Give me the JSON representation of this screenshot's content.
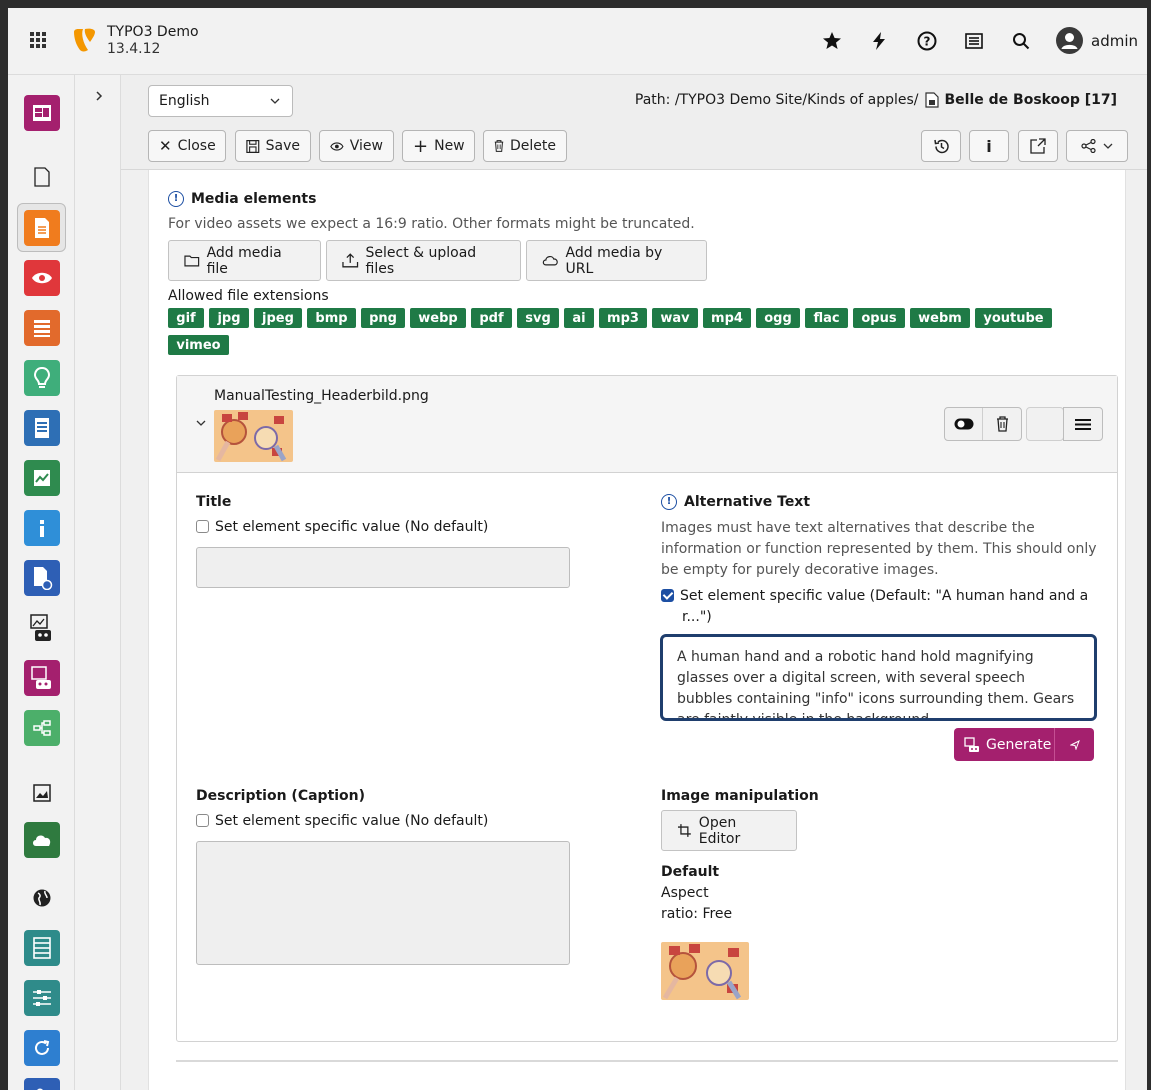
{
  "topbar": {
    "site_name": "TYPO3 Demo",
    "version": "13.4.12",
    "user": "admin",
    "icons": [
      "star-icon",
      "bolt-icon",
      "help-icon",
      "list-icon",
      "search-icon",
      "user-avatar-icon"
    ]
  },
  "docheader": {
    "language": "English",
    "path_label": "Path: /TYPO3 Demo Site/Kinds of apples/",
    "record_title": "Belle de Boskoop [17]",
    "buttons": {
      "close": "Close",
      "save": "Save",
      "view": "View",
      "new": "New",
      "delete": "Delete"
    }
  },
  "media": {
    "heading": "Media elements",
    "hint": "For video assets we expect a 16:9 ratio. Other formats might be truncated.",
    "add_media_file": "Add media file",
    "select_upload": "Select & upload files",
    "add_by_url": "Add media by URL",
    "allowed_label": "Allowed file extensions",
    "extensions": [
      "gif",
      "jpg",
      "jpeg",
      "bmp",
      "png",
      "webp",
      "pdf",
      "svg",
      "ai",
      "mp3",
      "wav",
      "mp4",
      "ogg",
      "flac",
      "opus",
      "webm",
      "youtube",
      "vimeo"
    ]
  },
  "file": {
    "name": "ManualTesting_Headerbild.png",
    "title_label": "Title",
    "title_checkbox": "Set element specific value (No default)",
    "alt_label": "Alternative Text",
    "alt_hint": "Images must have text alternatives that describe the information or function represented by them. This should only be empty for purely decorative images.",
    "alt_checkbox": "Set element specific value (Default: \"A human hand and a r...\")",
    "alt_value": "A human hand and a robotic hand hold magnifying glasses over a digital screen, with several speech bubbles containing \"info\" icons surrounding them. Gears are faintly visible in the background.",
    "generate": "Generate",
    "desc_label": "Description (Caption)",
    "desc_checkbox": "Set element specific value (No default)",
    "manip_label": "Image manipulation",
    "open_editor": "Open Editor",
    "default_label": "Default",
    "aspect_line1": "Aspect",
    "aspect_line2": "ratio: Free"
  },
  "colors": {
    "accent_blue": "#1d4fa3",
    "ext_green": "#1f7a46",
    "generate_magenta": "#a4206e",
    "typo3_orange": "#f49700"
  }
}
